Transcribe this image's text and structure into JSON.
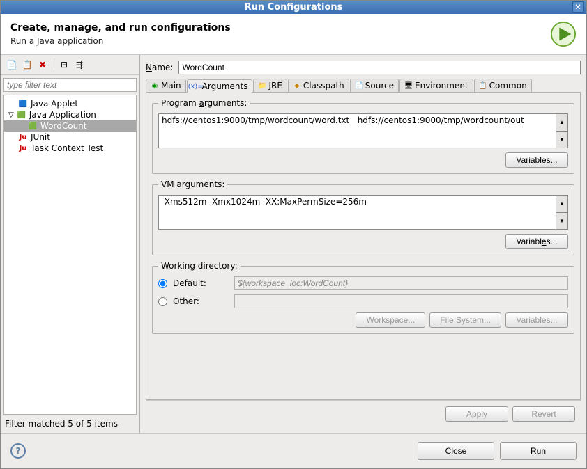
{
  "title": "Run Configurations",
  "header": {
    "title": "Create, manage, and run configurations",
    "subtitle": "Run a Java application"
  },
  "sidebar": {
    "filter_placeholder": "type filter text",
    "items": [
      {
        "label": "Java Applet"
      },
      {
        "label": "Java Application",
        "expanded": true
      },
      {
        "label": "WordCount",
        "child": true,
        "selected": true
      },
      {
        "label": "JUnit"
      },
      {
        "label": "Task Context Test"
      }
    ],
    "status": "Filter matched 5 of 5 items"
  },
  "form": {
    "name_label": "Name:",
    "name_value": "WordCount",
    "tabs": [
      {
        "label": "Main"
      },
      {
        "label": "Arguments",
        "active": true
      },
      {
        "label": "JRE"
      },
      {
        "label": "Classpath"
      },
      {
        "label": "Source"
      },
      {
        "label": "Environment"
      },
      {
        "label": "Common"
      }
    ],
    "program_args_label": "Program arguments:",
    "program_args_value": "hdfs://centos1:9000/tmp/wordcount/word.txt   hdfs://centos1:9000/tmp/wordcount/out",
    "vm_args_label": "VM arguments:",
    "vm_args_value": "-Xms512m -Xmx1024m -XX:MaxPermSize=256m",
    "variables_btn": "Variables...",
    "working_dir": {
      "legend": "Working directory:",
      "default_label": "Default:",
      "default_value": "${workspace_loc:WordCount}",
      "other_label": "Other:",
      "workspace_btn": "Workspace...",
      "filesystem_btn": "File System...",
      "variables_btn": "Variables..."
    },
    "apply_btn": "Apply",
    "revert_btn": "Revert"
  },
  "footer": {
    "close_btn": "Close",
    "run_btn": "Run"
  }
}
